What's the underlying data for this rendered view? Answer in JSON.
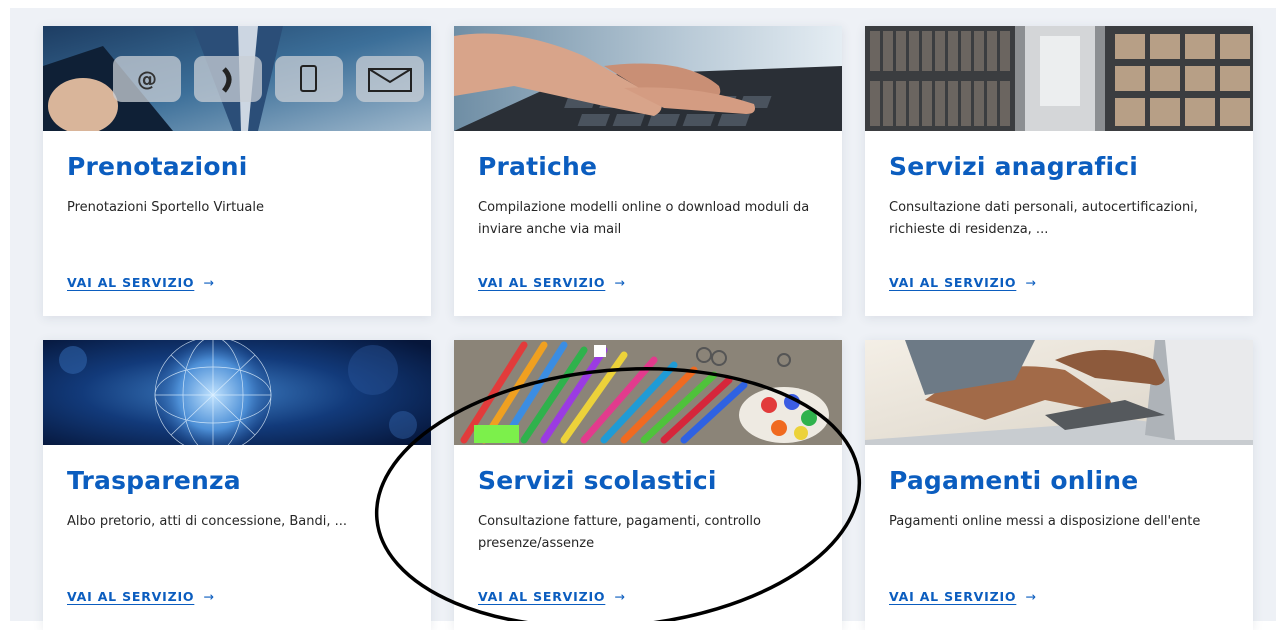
{
  "cards": [
    {
      "title": "Prenotazioni",
      "description": "Prenotazioni Sportello Virtuale",
      "link_label": "VAI AL SERVIZIO",
      "image_icon": "communication-icons-image"
    },
    {
      "title": "Pratiche",
      "description": "Compilazione modelli online o download moduli da inviare anche via mail",
      "link_label": "VAI AL SERVIZIO",
      "image_icon": "keyboard-hand-image"
    },
    {
      "title": "Servizi anagrafici",
      "description": "Consultazione dati personali, autocertificazioni, richieste di residenza, ...",
      "link_label": "VAI AL SERVIZIO",
      "image_icon": "archive-shelves-image"
    },
    {
      "title": "Trasparenza",
      "description": "Albo pretorio, atti di concessione, Bandi, ...",
      "link_label": "VAI AL SERVIZIO",
      "image_icon": "network-globe-image"
    },
    {
      "title": "Servizi scolastici",
      "description": "Consultazione fatture, pagamenti, controllo presenze/assenze",
      "link_label": "VAI AL SERVIZIO",
      "image_icon": "school-supplies-image"
    },
    {
      "title": "Pagamenti online",
      "description": "Pagamenti online messi a disposizione dell'ente",
      "link_label": "VAI AL SERVIZIO",
      "image_icon": "laptop-typing-image"
    }
  ],
  "link_arrow": "→",
  "colors": {
    "accent": "#0b5dbf",
    "background": "#eef1f6",
    "card": "#ffffff",
    "text": "#262626"
  }
}
